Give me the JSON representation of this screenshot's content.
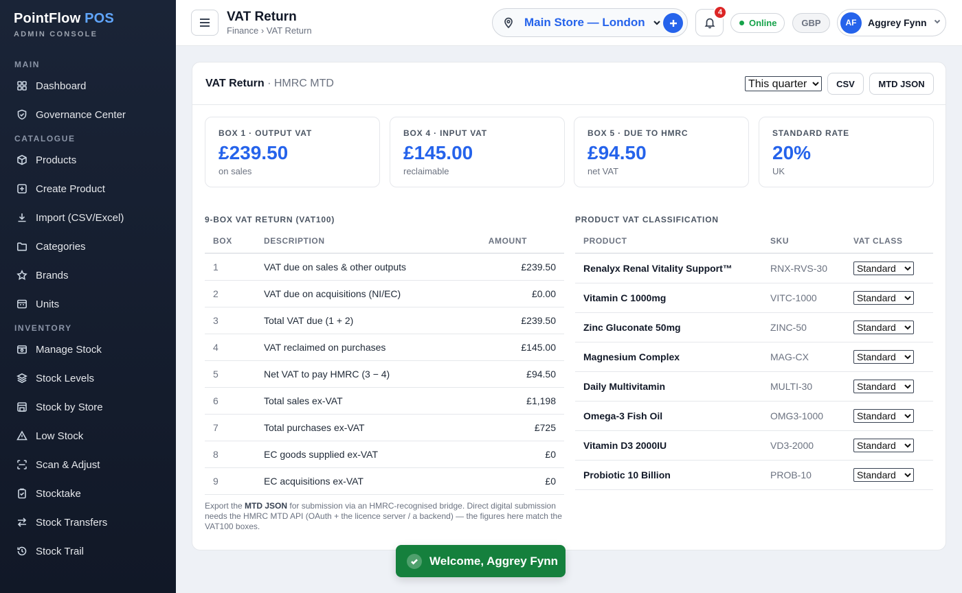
{
  "brand": {
    "name_main": "PointFlow",
    "name_accent": "POS",
    "subtitle": "ADMIN CONSOLE"
  },
  "sidebar": {
    "sections": [
      {
        "title": "MAIN",
        "items": [
          {
            "label": "Dashboard",
            "icon": "grid-icon"
          },
          {
            "label": "Governance Center",
            "icon": "shield-icon"
          }
        ]
      },
      {
        "title": "CATALOGUE",
        "items": [
          {
            "label": "Products",
            "icon": "box-icon"
          },
          {
            "label": "Create Product",
            "icon": "plus-square-icon"
          },
          {
            "label": "Import (CSV/Excel)",
            "icon": "download-icon"
          },
          {
            "label": "Categories",
            "icon": "folder-icon"
          },
          {
            "label": "Brands",
            "icon": "star-icon"
          },
          {
            "label": "Units",
            "icon": "units-icon"
          }
        ]
      },
      {
        "title": "INVENTORY",
        "items": [
          {
            "label": "Manage Stock",
            "icon": "stock-box-icon"
          },
          {
            "label": "Stock Levels",
            "icon": "layers-icon"
          },
          {
            "label": "Stock by Store",
            "icon": "store-icon"
          },
          {
            "label": "Low Stock",
            "icon": "warning-icon"
          },
          {
            "label": "Scan & Adjust",
            "icon": "scan-icon"
          },
          {
            "label": "Stocktake",
            "icon": "clipboard-icon"
          },
          {
            "label": "Stock Transfers",
            "icon": "transfer-icon"
          },
          {
            "label": "Stock Trail",
            "icon": "history-icon"
          }
        ]
      }
    ]
  },
  "header": {
    "title": "VAT Return",
    "breadcrumb": "Finance › VAT Return",
    "store": "Main Store — London",
    "notifications_count": "4",
    "status": "Online",
    "currency": "GBP",
    "user_initials": "AF",
    "user_name": "Aggrey Fynn"
  },
  "card": {
    "title": "VAT Return",
    "subtitle": "· HMRC MTD",
    "period_selected": "This quarter",
    "csv_label": "CSV",
    "mtd_label": "MTD JSON"
  },
  "stats": [
    {
      "label": "BOX 1 · OUTPUT VAT",
      "value": "£239.50",
      "note": "on sales"
    },
    {
      "label": "BOX 4 · INPUT VAT",
      "value": "£145.00",
      "note": "reclaimable"
    },
    {
      "label": "BOX 5 · DUE TO HMRC",
      "value": "£94.50",
      "note": "net VAT"
    },
    {
      "label": "STANDARD RATE",
      "value": "20%",
      "note": "UK"
    }
  ],
  "vat_table": {
    "title": "9-BOX VAT RETURN (VAT100)",
    "headers": [
      "BOX",
      "DESCRIPTION",
      "AMOUNT"
    ],
    "rows": [
      [
        "1",
        "VAT due on sales & other outputs",
        "£239.50"
      ],
      [
        "2",
        "VAT due on acquisitions (NI/EC)",
        "£0.00"
      ],
      [
        "3",
        "Total VAT due (1 + 2)",
        "£239.50"
      ],
      [
        "4",
        "VAT reclaimed on purchases",
        "£145.00"
      ],
      [
        "5",
        "Net VAT to pay HMRC (3 − 4)",
        "£94.50"
      ],
      [
        "6",
        "Total sales ex-VAT",
        "£1,198"
      ],
      [
        "7",
        "Total purchases ex-VAT",
        "£725"
      ],
      [
        "8",
        "EC goods supplied ex-VAT",
        "£0"
      ],
      [
        "9",
        "EC acquisitions ex-VAT",
        "£0"
      ]
    ]
  },
  "footnote": {
    "pre": "Export the ",
    "bold": "MTD JSON",
    "post": " for submission via an HMRC-recognised bridge. Direct digital submission needs the HMRC MTD API (OAuth + the licence server / a backend) — the figures here match the VAT100 boxes."
  },
  "product_table": {
    "title": "PRODUCT VAT CLASSIFICATION",
    "headers": [
      "PRODUCT",
      "SKU",
      "VAT CLASS"
    ],
    "rows": [
      {
        "product": "Renalyx Renal Vitality Support™",
        "sku": "RNX-RVS-30",
        "vat_class": "Standard"
      },
      {
        "product": "Vitamin C 1000mg",
        "sku": "VITC-1000",
        "vat_class": "Standard"
      },
      {
        "product": "Zinc Gluconate 50mg",
        "sku": "ZINC-50",
        "vat_class": "Standard"
      },
      {
        "product": "Magnesium Complex",
        "sku": "MAG-CX",
        "vat_class": "Standard"
      },
      {
        "product": "Daily Multivitamin",
        "sku": "MULTI-30",
        "vat_class": "Standard"
      },
      {
        "product": "Omega-3 Fish Oil",
        "sku": "OMG3-1000",
        "vat_class": "Standard"
      },
      {
        "product": "Vitamin D3 2000IU",
        "sku": "VD3-2000",
        "vat_class": "Standard"
      },
      {
        "product": "Probiotic 10 Billion",
        "sku": "PROB-10",
        "vat_class": "Standard"
      }
    ]
  },
  "toast": {
    "message": "Welcome, Aggrey Fynn"
  },
  "colors": {
    "accent": "#2563eb",
    "sidebar": "#111827",
    "success": "#15803d",
    "danger": "#dc2626"
  }
}
